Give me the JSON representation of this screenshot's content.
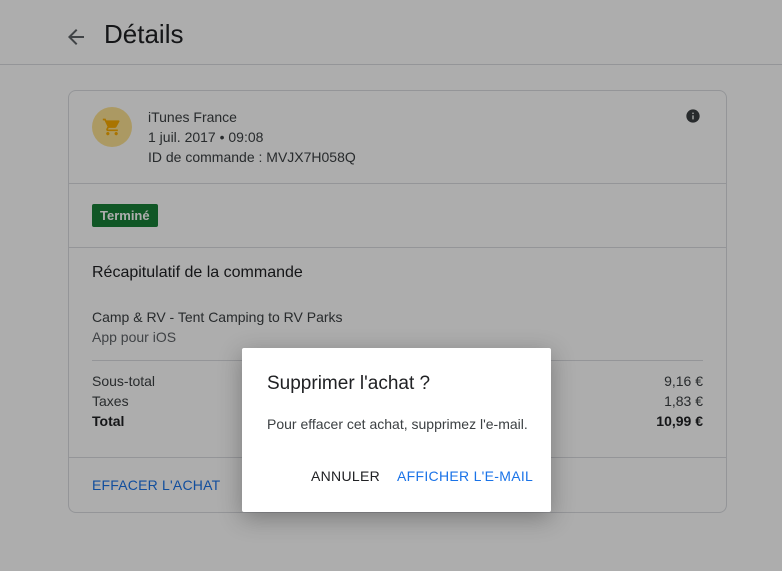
{
  "header": {
    "title": "Détails"
  },
  "merchant": {
    "name": "iTunes France",
    "date": "1 juil. 2017 • 09:08",
    "order_id": "ID de commande : MVJX7H058Q"
  },
  "status": {
    "label": "Terminé",
    "color": "#188038"
  },
  "summary": {
    "title": "Récapitulatif de la commande",
    "product_name": "Camp & RV - Tent Camping to RV Parks",
    "product_type": "App pour iOS",
    "rows": [
      {
        "label": "Sous-total",
        "value": "9,16 €"
      },
      {
        "label": "Taxes",
        "value": "1,83 €"
      },
      {
        "label": "Total",
        "value": "10,99 €"
      }
    ]
  },
  "footer": {
    "delete_label": "EFFACER L'ACHAT"
  },
  "dialog": {
    "title": "Supprimer l'achat ?",
    "message": "Pour effacer cet achat, supprimez l'e-mail.",
    "cancel_label": "ANNULER",
    "confirm_label": "AFFICHER L'E-MAIL"
  },
  "icons": {
    "back": "arrow-back-icon",
    "cart": "shopping-cart-icon",
    "info": "info-icon"
  },
  "colors": {
    "accent": "#1a73e8",
    "avatar_bg": "#fde293",
    "cart": "#f9ab00"
  }
}
